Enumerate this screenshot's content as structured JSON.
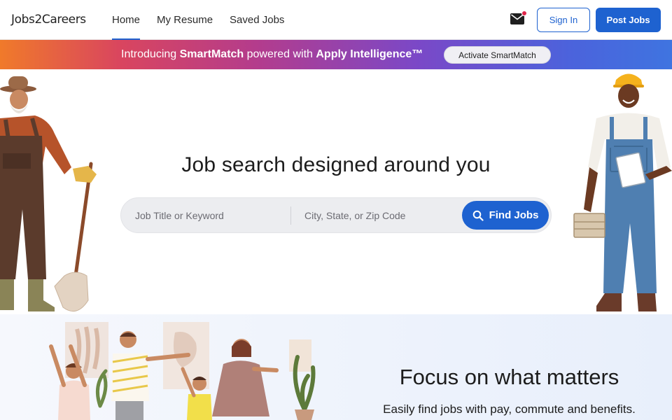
{
  "header": {
    "logo": "Jobs2Careers",
    "nav": [
      {
        "label": "Home",
        "active": true
      },
      {
        "label": "My Resume",
        "active": false
      },
      {
        "label": "Saved Jobs",
        "active": false
      }
    ],
    "mail_icon": "mail-icon",
    "sign_in_label": "Sign In",
    "post_jobs_label": "Post Jobs"
  },
  "banner": {
    "text_intro": "Introducing ",
    "text_brand": "SmartMatch",
    "text_mid": " powered with ",
    "text_product": "Apply Intelligence™",
    "activate_label": "Activate SmartMatch"
  },
  "hero": {
    "title": "Job search designed around you",
    "keyword_placeholder": "Job Title or Keyword",
    "location_placeholder": "City, State, or Zip Code",
    "find_label": "Find Jobs",
    "find_icon": "search-icon"
  },
  "feature": {
    "title": "Focus on what matters",
    "subtitle": "Easily find jobs with pay, commute and benefits."
  },
  "colors": {
    "primary": "#1e62d0",
    "banner_start": "#f07a2a",
    "banner_end": "#3f74e0",
    "notification": "#e0264a"
  }
}
